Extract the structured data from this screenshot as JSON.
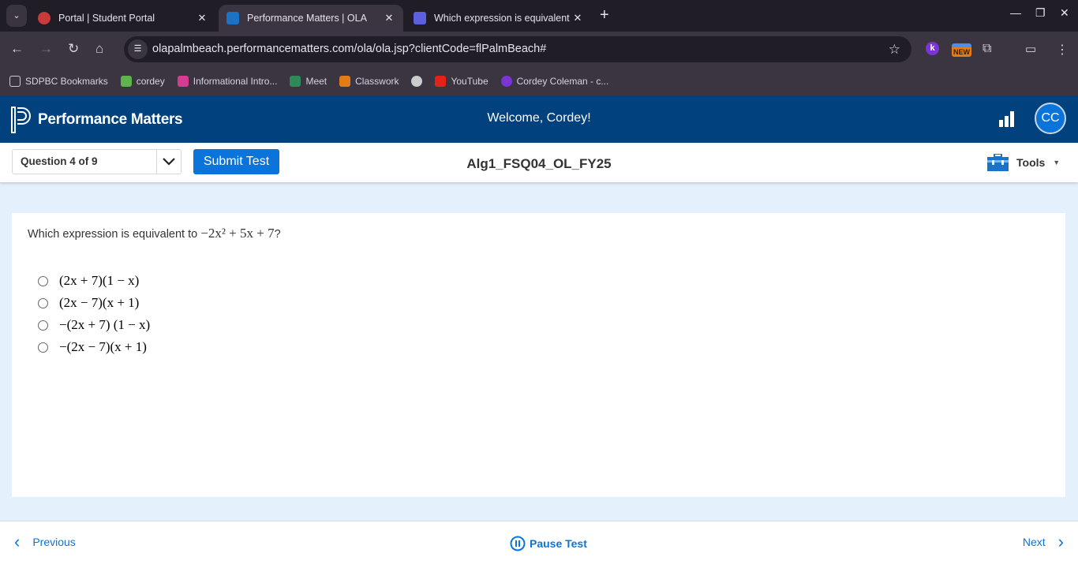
{
  "browser": {
    "tabs": [
      {
        "title": "Portal | Student Portal",
        "favicon_color": "#c93a3a"
      },
      {
        "title": "Performance Matters | OLA",
        "favicon_color": "#1a73c7",
        "active": true
      },
      {
        "title": "Which expression is equivalent",
        "favicon_color": "#5b5fe0"
      }
    ],
    "url": "olapalmbeach.performancematters.com/ola/ola.jsp?clientCode=flPalmBeach#",
    "ext_badge": "NEW",
    "bookmarks": [
      {
        "label": "SDPBC Bookmarks",
        "icon": "folder-icon"
      },
      {
        "label": "cordey",
        "icon": "cube-icon",
        "color": "#5fb34c"
      },
      {
        "label": "Informational Intro...",
        "icon": "classroom-icon",
        "color": "#d63b8f"
      },
      {
        "label": "Meet",
        "icon": "meet-icon",
        "color": "#2e8b57"
      },
      {
        "label": "Classwork",
        "icon": "classroom-icon",
        "color": "#e37b16"
      },
      {
        "label": "",
        "icon": "globe-icon",
        "color": "#cccccc"
      },
      {
        "label": "YouTube",
        "icon": "youtube-icon",
        "color": "#e62117"
      },
      {
        "label": "Cordey Coleman - c...",
        "icon": "k-icon",
        "color": "#7b35d6"
      }
    ]
  },
  "app": {
    "brand": "Performance Matters",
    "welcome": "Welcome, Cordey!",
    "avatar_initials": "CC",
    "question_selector": "Question 4 of 9",
    "submit_label": "Submit Test",
    "test_name": "Alg1_FSQ04_OL_FY25",
    "tools_label": "Tools",
    "accent": "#0a74da",
    "header_color": "#00417e"
  },
  "question": {
    "prompt": "Which expression is equivalent to",
    "expression": "−2x² + 5x + 7",
    "suffix": "?",
    "options": [
      "(2x + 7)(1 − x)",
      "(2x − 7)(x + 1)",
      "−(2x + 7) (1 − x)",
      "−(2x − 7)(x + 1)"
    ]
  },
  "footer": {
    "previous": "Previous",
    "pause": "Pause Test",
    "next": "Next"
  }
}
